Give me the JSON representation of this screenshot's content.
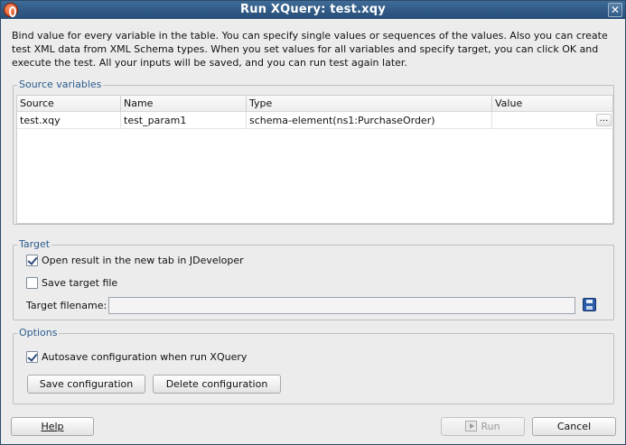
{
  "window": {
    "title": "Run XQuery: test.xqy"
  },
  "description": "Bind value for every variable in the table. You can specify single values or sequences of the values. Also you can create test XML data from XML Schema types. When you set values for all variables and specify target, you can click OK and execute the test. All your inputs will be saved, and you can run test again later.",
  "source_variables": {
    "legend": "Source variables",
    "columns": [
      "Source",
      "Name",
      "Type",
      "Value"
    ],
    "rows": [
      {
        "source": "test.xqy",
        "name": "test_param1",
        "type": "schema-element(ns1:PurchaseOrder)",
        "value": "",
        "ellipsis": "..."
      }
    ]
  },
  "target": {
    "legend": "Target",
    "open_result_label": "Open result in the new tab in JDeveloper",
    "open_result_checked": true,
    "save_target_label": "Save target file",
    "save_target_checked": false,
    "filename_label": "Target filename:",
    "filename_value": ""
  },
  "options": {
    "legend": "Options",
    "autosave_label": "Autosave configuration when run XQuery",
    "autosave_checked": true,
    "save_config_label": "Save configuration",
    "delete_config_label": "Delete configuration"
  },
  "footer": {
    "help_label": "Help",
    "run_label": "Run",
    "cancel_label": "Cancel"
  }
}
